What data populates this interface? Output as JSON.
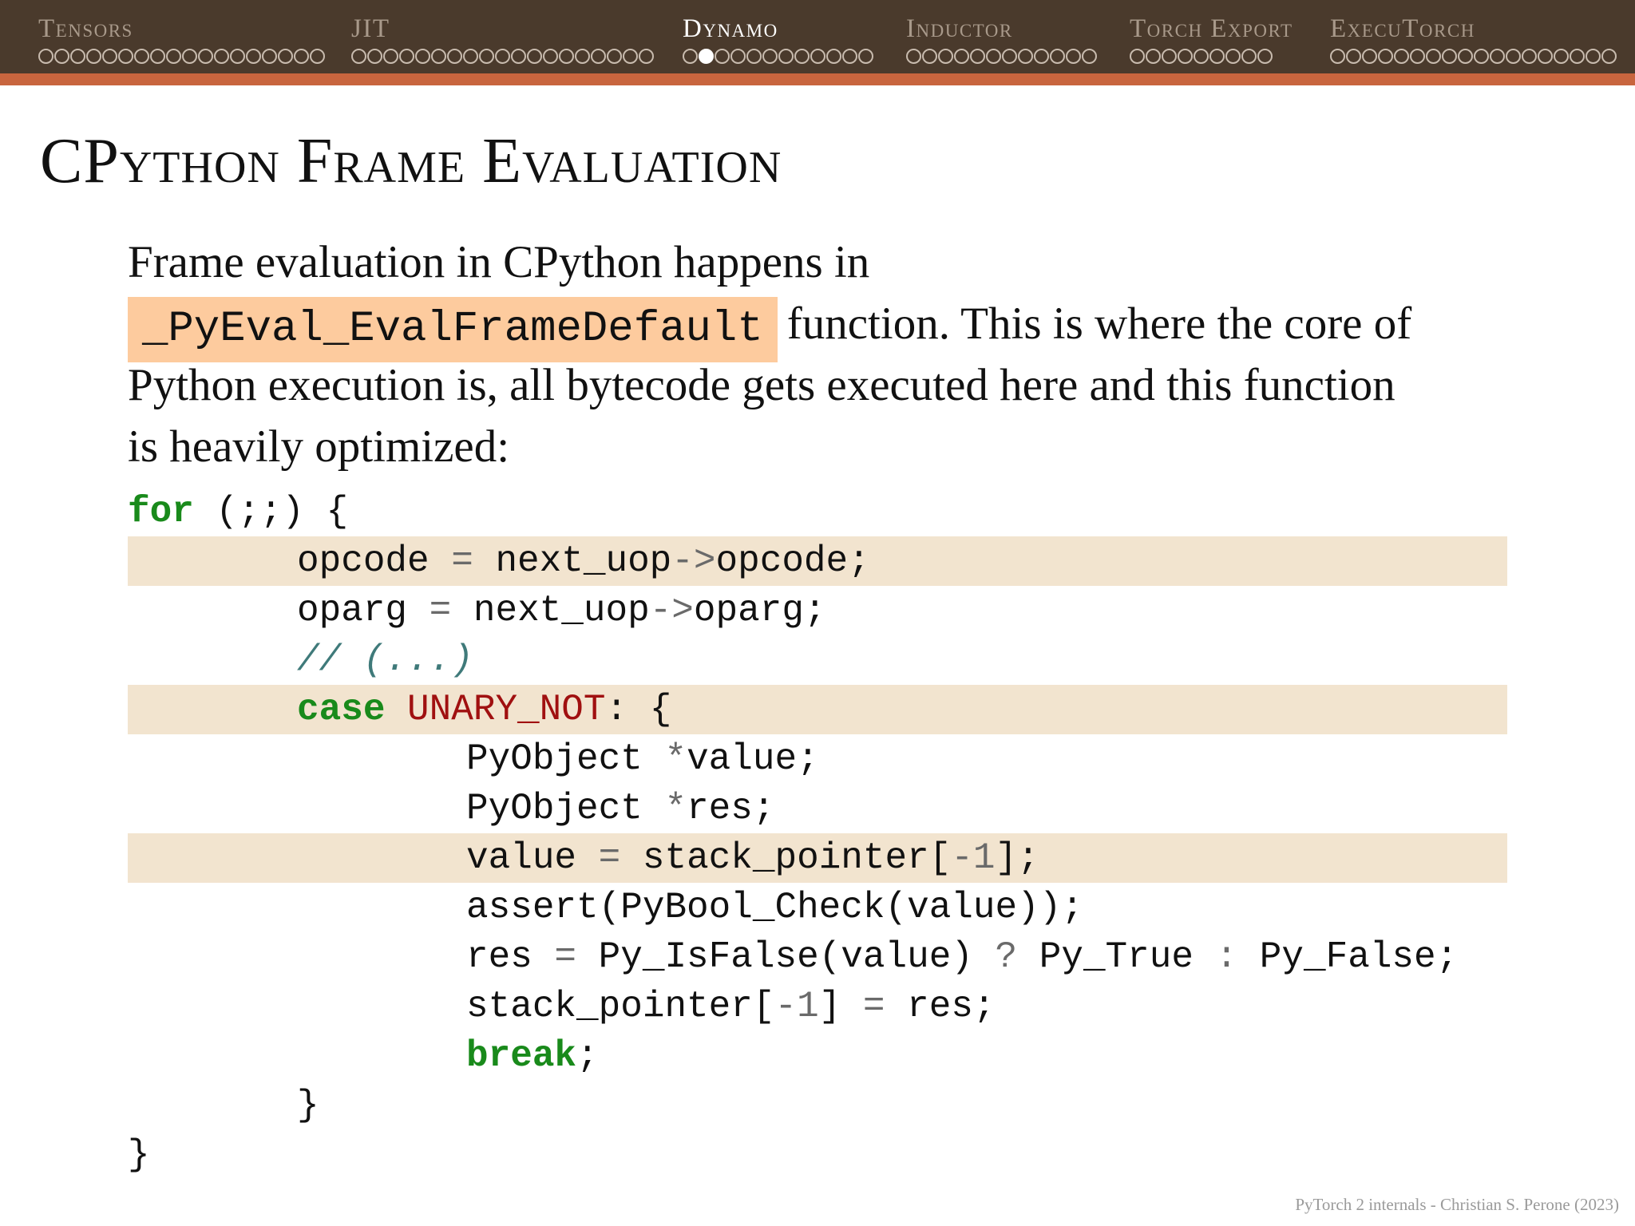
{
  "navigation": {
    "sections": [
      {
        "name": "Tensors",
        "dot_count": 18,
        "current_dot": null
      },
      {
        "name": "JIT",
        "dot_count": 19,
        "current_dot": null
      },
      {
        "name": "Dynamo",
        "dot_count": 12,
        "current_dot": 2
      },
      {
        "name": "Inductor",
        "dot_count": 12,
        "current_dot": null
      },
      {
        "name": "Torch Export",
        "dot_count": 9,
        "current_dot": null
      },
      {
        "name": "ExecuTorch",
        "dot_count": 18,
        "current_dot": null
      }
    ],
    "current_section": "Dynamo"
  },
  "colors": {
    "navbar_bg": "#4a3a2c",
    "navbar_accent": "#c8653e",
    "function_highlight": "#fdcb9e",
    "code_highlight": "#f2e4cf",
    "keyword": "#198a1b",
    "constant": "#a01010",
    "comment": "#3f7a7a"
  },
  "slide": {
    "title": "CPython Frame Evaluation",
    "intro": {
      "line1": "Frame evaluation in CPython happens in",
      "function_name": "_PyEval_EvalFrameDefault",
      "line2_rest": "function. This is where the core of",
      "line3": "Python execution is, all bytecode gets executed here and this function",
      "line4": "is heavily optimized:"
    },
    "code": {
      "l1": {
        "kw": "for",
        "rest": " (;;) {"
      },
      "l2": {
        "a": "opcode ",
        "op": "=",
        "b": " next_uop",
        "arrow": "->",
        "c": "opcode;"
      },
      "l3": {
        "a": "oparg ",
        "op": "=",
        "b": " next_uop",
        "arrow": "->",
        "c": "oparg;"
      },
      "l4": {
        "comment": "// (...)"
      },
      "l5": {
        "kw": "case",
        "sp": " ",
        "const": "UNARY_NOT",
        "rest": ": {"
      },
      "l6": {
        "a": "PyObject ",
        "op": "*",
        "b": "value;"
      },
      "l7": {
        "a": "PyObject ",
        "op": "*",
        "b": "res;"
      },
      "l8": {
        "a": "value ",
        "op": "=",
        "b": " stack_pointer[",
        "num": "-1",
        "c": "];"
      },
      "l9": {
        "text": "assert(PyBool_Check(value));"
      },
      "l10": {
        "a": "res ",
        "op1": "=",
        "b": " Py_IsFalse(value) ",
        "op2": "?",
        "c": " Py_True ",
        "op3": ":",
        "d": " Py_False;"
      },
      "l11": {
        "a": "stack_pointer[",
        "num": "-1",
        "b": "] ",
        "op": "=",
        "c": " res;"
      },
      "l12": {
        "kw": "break",
        "rest": ";"
      },
      "l13": {
        "text": "}"
      },
      "l14": {
        "text": "}"
      }
    },
    "footer": "PyTorch 2 internals - Christian S. Perone (2023)"
  }
}
